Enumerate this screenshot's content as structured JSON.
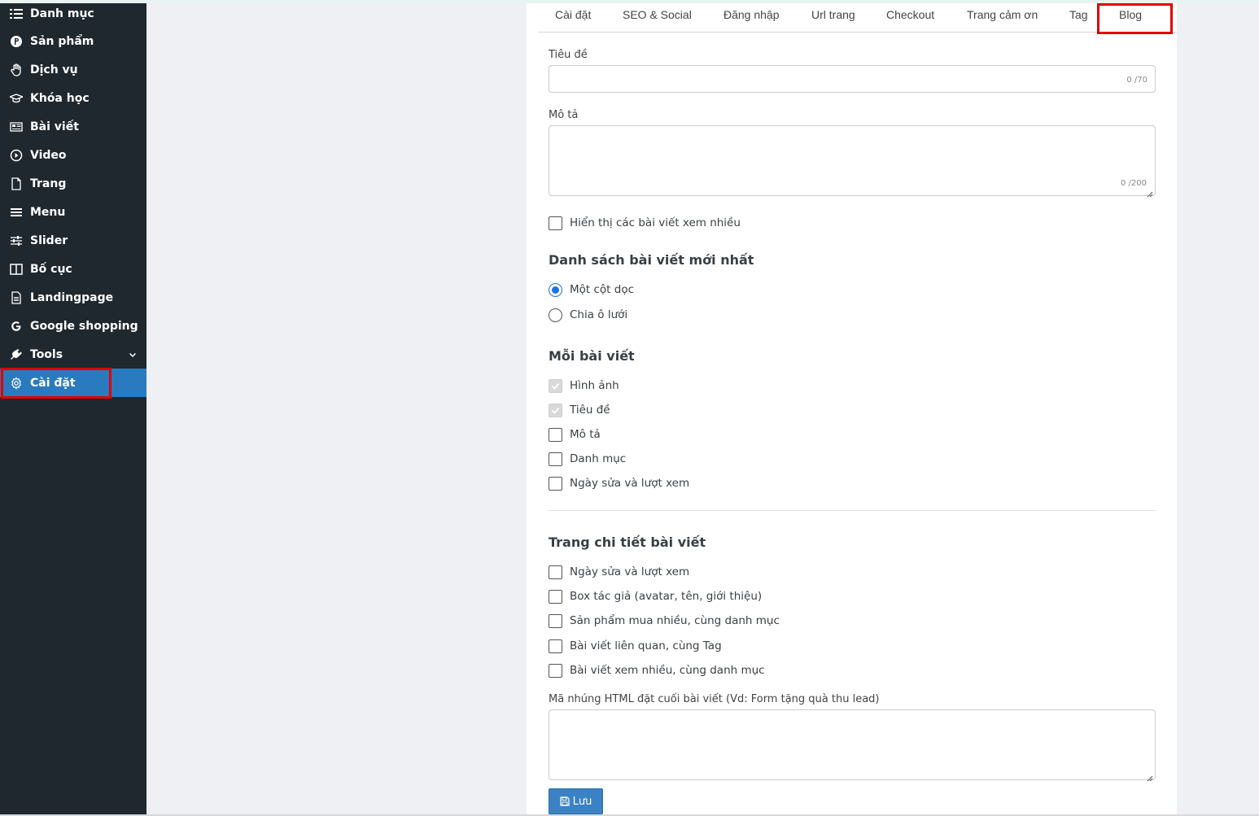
{
  "sidebar": {
    "items": [
      {
        "label": "Danh mục",
        "icon": "list-icon"
      },
      {
        "label": "Sản phẩm",
        "icon": "product-p-icon"
      },
      {
        "label": "Dịch vụ",
        "icon": "hand-icon"
      },
      {
        "label": "Khóa học",
        "icon": "graduation-cap-icon"
      },
      {
        "label": "Bài viết",
        "icon": "newspaper-icon"
      },
      {
        "label": "Video",
        "icon": "play-circle-icon"
      },
      {
        "label": "Trang",
        "icon": "file-icon"
      },
      {
        "label": "Menu",
        "icon": "bars-icon"
      },
      {
        "label": "Slider",
        "icon": "sliders-icon"
      },
      {
        "label": "Bố cục",
        "icon": "columns-icon"
      },
      {
        "label": "Landingpage",
        "icon": "file-text-icon"
      },
      {
        "label": "Google shopping",
        "icon": "google-icon"
      },
      {
        "label": "Tools",
        "icon": "plug-icon"
      },
      {
        "label": "Cài đặt",
        "icon": "gear-icon"
      }
    ],
    "active_item": "Cài đặt",
    "active_color": "#2a7abf",
    "background": "#1f282f"
  },
  "tabs": {
    "items": [
      "Cài đặt",
      "SEO & Social",
      "Đăng nhập",
      "Url trang",
      "Checkout",
      "Trang cảm ơn",
      "Tag",
      "Blog"
    ],
    "active": "Blog"
  },
  "form": {
    "title_label": "Tiêu đề",
    "title_value": "",
    "title_counter": "0 /70",
    "desc_label": "Mô tả",
    "desc_value": "",
    "desc_counter": "0 /200",
    "show_popular_label": "Hiển thị các bài viết xem nhiều",
    "show_popular_checked": false,
    "latest_list": {
      "heading": "Danh sách bài viết mới nhất",
      "options": [
        "Một cột dọc",
        "Chia ô lưới"
      ],
      "selected": "Một cột dọc"
    },
    "each_post": {
      "heading": "Mỗi bài viết",
      "options": [
        {
          "label": "Hình ảnh",
          "checked": true,
          "disabled": true
        },
        {
          "label": "Tiêu đề",
          "checked": true,
          "disabled": true
        },
        {
          "label": "Mô tả",
          "checked": false,
          "disabled": false
        },
        {
          "label": "Danh mục",
          "checked": false,
          "disabled": false
        },
        {
          "label": "Ngày sửa và lượt xem",
          "checked": false,
          "disabled": false
        }
      ]
    },
    "detail_page": {
      "heading": "Trang chi tiết bài viết",
      "options": [
        {
          "label": "Ngày sửa và lượt xem",
          "checked": false
        },
        {
          "label": "Box tác giả (avatar, tên, giới thiệu)",
          "checked": false
        },
        {
          "label": "Sản phẩm mua nhiều, cùng danh mục",
          "checked": false
        },
        {
          "label": "Bài viết liên quan, cùng Tag",
          "checked": false
        },
        {
          "label": "Bài viết xem nhiều, cùng danh mục",
          "checked": false
        }
      ]
    },
    "embed_label": "Mã nhúng HTML đặt cuối bài viết (Vd: Form tặng quà thu lead)",
    "embed_value": "",
    "save_label": "Lưu"
  },
  "colors": {
    "highlight": "#e00000",
    "primary": "#3b82c4",
    "radio": "#1a73e8"
  }
}
